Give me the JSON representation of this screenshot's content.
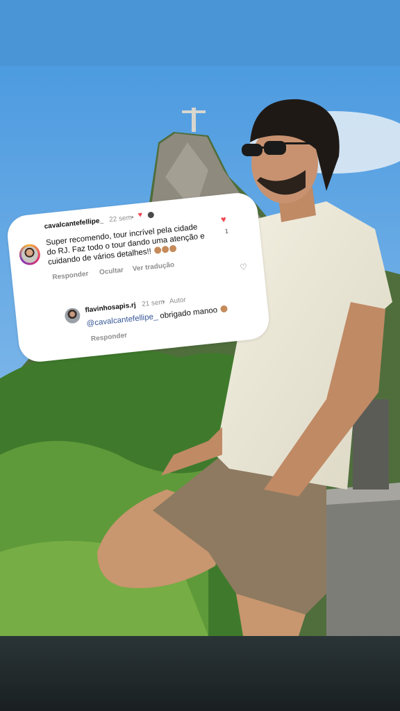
{
  "comment": {
    "username": "cavalcantefellipe_",
    "time": "22 sem",
    "separator": "•",
    "text_lines": [
      "Super recomendo, tour incrível pela cidade",
      "do RJ. Faz todo o tour dando uma atenção e",
      "cuidando de vários detalhes!!"
    ],
    "actions": {
      "reply": "Responder",
      "hide": "Ocultar",
      "translate": "Ver tradução"
    },
    "like_count": "1"
  },
  "reply": {
    "username": "flavinhosapis.rj",
    "time": "21 sem",
    "separator": "•",
    "badge": "Autor",
    "mention": "@cavalcantefellipe_",
    "text": "obrigado manoo",
    "action": "Responder"
  },
  "colors": {
    "accent_red": "#ed4956",
    "mention_blue": "#385898",
    "sky": "#5aa3e0"
  },
  "icons": [
    "heart-filled-icon",
    "heart-outline-icon",
    "clap-emoji-icon"
  ]
}
